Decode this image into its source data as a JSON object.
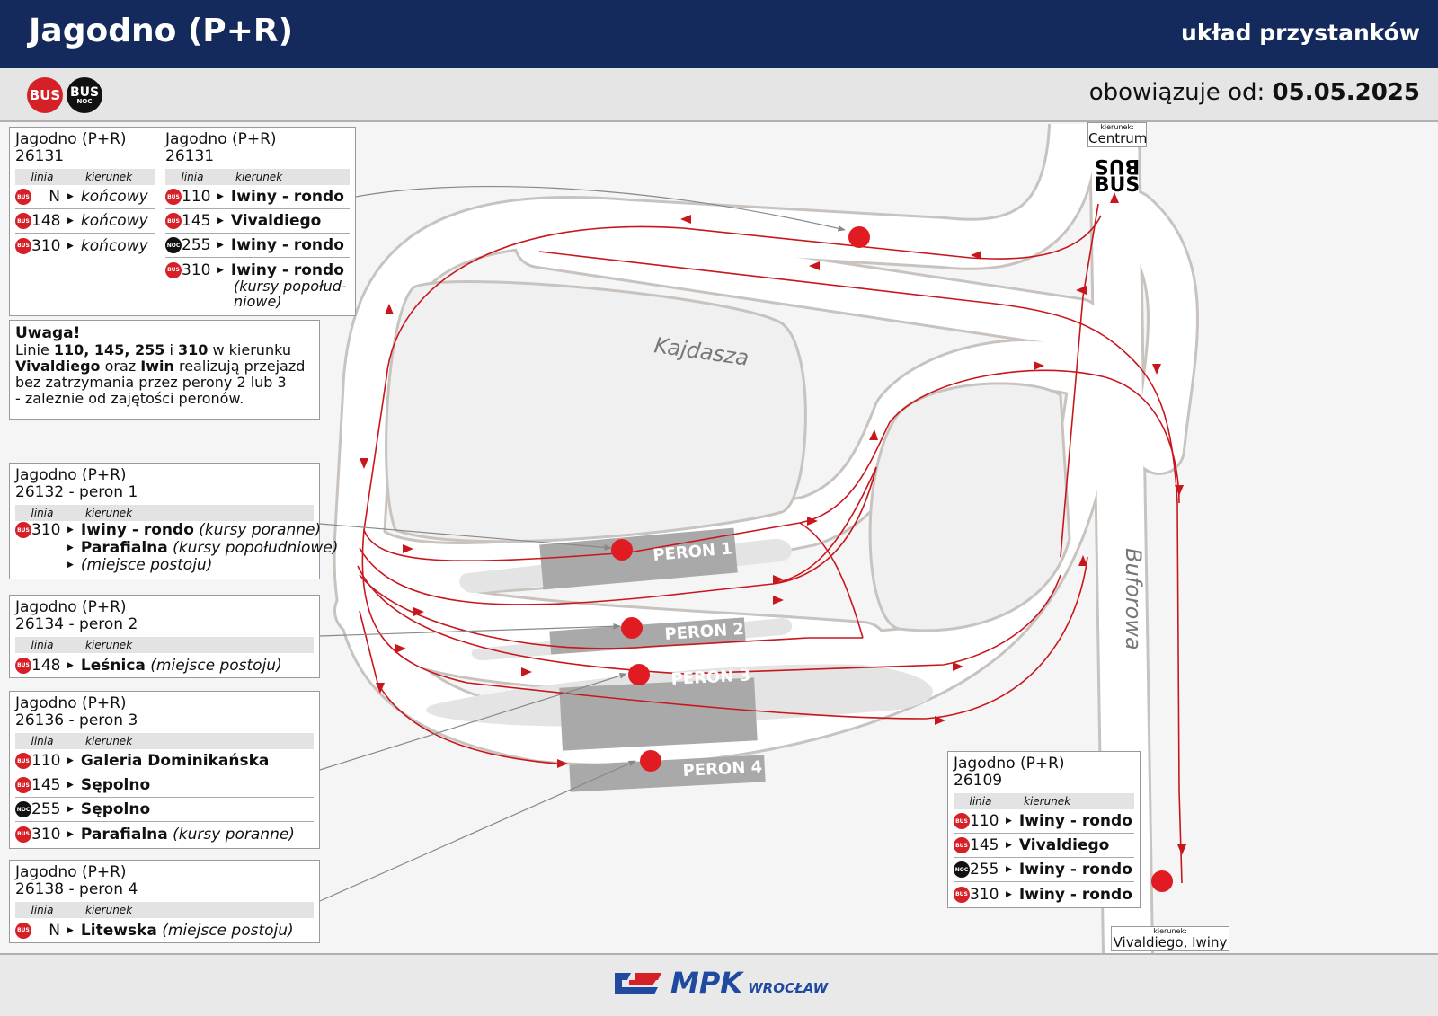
{
  "header": {
    "title": "Jagodno (P+R)",
    "subtitle": "układ przystanków",
    "badge_bus": "BUS",
    "badge_busnoc_top": "BUS",
    "badge_busnoc_bottom": "NOC",
    "valid_label": "obowiązuje od:",
    "valid_date": "05.05.2025"
  },
  "map": {
    "street_kajdasza": "Kajdasza",
    "street_buforowa": "Buforowa",
    "peron1": "PERON 1",
    "peron2": "PERON 2",
    "peron3": "PERON 3",
    "peron4": "PERON 4",
    "road_marking": "BUS",
    "direction_top_label": "kierunek:",
    "direction_top_value": "Centrum",
    "direction_bottom_label": "kierunek:",
    "direction_bottom_value": "Vivaldiego, Iwiny",
    "route_color": "#c8161d",
    "stop_color": "#e01b22"
  },
  "labels": {
    "linia": "linia",
    "kierunek": "kierunek"
  },
  "box1": {
    "name": "Jagodno (P+R)",
    "id": "26131",
    "rows": [
      {
        "type": "BUS",
        "line": "N",
        "dir": "",
        "dir_italic": "końcowy"
      },
      {
        "type": "BUS",
        "line": "148",
        "dir": "",
        "dir_italic": "końcowy"
      },
      {
        "type": "BUS",
        "line": "310",
        "dir": "",
        "dir_italic": "końcowy"
      }
    ]
  },
  "box2": {
    "name": "Jagodno (P+R)",
    "id": "26131",
    "rows": [
      {
        "type": "BUS",
        "line": "110",
        "dir": "Iwiny - rondo",
        "dir_italic": ""
      },
      {
        "type": "BUS",
        "line": "145",
        "dir": "Vivaldiego",
        "dir_italic": ""
      },
      {
        "type": "BUS NOC",
        "line": "255",
        "dir": "Iwiny - rondo",
        "dir_italic": ""
      },
      {
        "type": "BUS",
        "line": "310",
        "dir": "Iwiny - rondo",
        "dir_italic": ""
      }
    ],
    "extra1": "(kursy popołud-",
    "extra2": "niowe)"
  },
  "note": {
    "title": "Uwaga!",
    "l1a": "Linie ",
    "l1b": "110, 145, 255",
    "l1c": " i ",
    "l1d": "310",
    "l1e": " w kierunku",
    "l2a": "Vivaldiego",
    "l2b": " oraz ",
    "l2c": "Iwin",
    "l2d": " realizują przejazd",
    "l3": "bez zatrzymania przez perony 2 lub 3",
    "l4": " - zależnie od zajętości peronów."
  },
  "box3": {
    "name": "Jagodno (P+R)",
    "id": "26132 - peron 1",
    "r1_line": "310",
    "r1_dir": "Iwiny - rondo",
    "r1_it": " (kursy poranne)",
    "r2_dir": "Parafialna",
    "r2_it": " (kursy popołudniowe)",
    "r3_it": "(miejsce postoju)"
  },
  "box4": {
    "name": "Jagodno (P+R)",
    "id": "26134 - peron 2",
    "rows": [
      {
        "type": "BUS",
        "line": "148",
        "dir": "Leśnica",
        "dir_italic": " (miejsce postoju)"
      }
    ]
  },
  "box5": {
    "name": "Jagodno (P+R)",
    "id": "26136 - peron 3",
    "rows": [
      {
        "type": "BUS",
        "line": "110",
        "dir": "Galeria Dominikańska",
        "dir_italic": ""
      },
      {
        "type": "BUS",
        "line": "145",
        "dir": "Sępolno",
        "dir_italic": ""
      },
      {
        "type": "BUS NOC",
        "line": "255",
        "dir": "Sępolno",
        "dir_italic": ""
      },
      {
        "type": "BUS",
        "line": "310",
        "dir": "Parafialna",
        "dir_italic": " (kursy poranne)"
      }
    ]
  },
  "box6": {
    "name": "Jagodno (P+R)",
    "id": "26138 - peron 4",
    "rows": [
      {
        "type": "BUS",
        "line": "N",
        "dir": "Litewska",
        "dir_italic": " (miejsce postoju)"
      }
    ]
  },
  "box7": {
    "name": "Jagodno (P+R)",
    "id": "26109",
    "rows": [
      {
        "type": "BUS",
        "line": "110",
        "dir": "Iwiny - rondo",
        "dir_italic": ""
      },
      {
        "type": "BUS",
        "line": "145",
        "dir": "Vivaldiego",
        "dir_italic": ""
      },
      {
        "type": "BUS NOC",
        "line": "255",
        "dir": "Iwiny - rondo",
        "dir_italic": ""
      },
      {
        "type": "BUS",
        "line": "310",
        "dir": "Iwiny - rondo",
        "dir_italic": ""
      }
    ]
  },
  "footer": {
    "logo_text": "MPK",
    "logo_city": "WROCŁAW"
  }
}
